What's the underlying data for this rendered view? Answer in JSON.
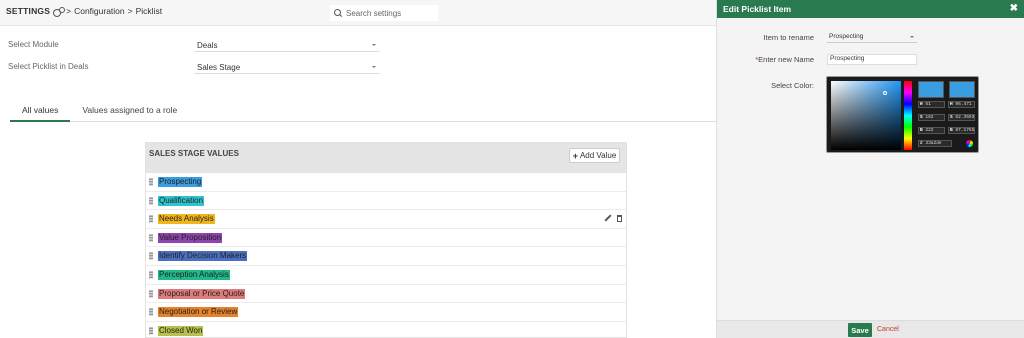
{
  "header": {
    "settings_label": "SETTINGS",
    "crumb_sep": ">",
    "breadcrumb": [
      "Configuration",
      "Picklist"
    ],
    "search_placeholder": "Search settings"
  },
  "filters": {
    "module_label": "Select Module",
    "module_value": "Deals",
    "picklist_label": "Select Picklist in Deals",
    "picklist_value": "Sales Stage"
  },
  "tabs": [
    {
      "label": "All values",
      "active": true
    },
    {
      "label": "Values assigned to a role",
      "active": false
    }
  ],
  "panel": {
    "title": "SALES STAGE VALUES",
    "add_icon": "plus-icon",
    "add_label": "Add Value",
    "values": [
      {
        "label": "Prospecting",
        "color": "#3a9de0"
      },
      {
        "label": "Qualification",
        "color": "#2ec4cf"
      },
      {
        "label": "Needs Analysis",
        "color": "#f2b61d"
      },
      {
        "label": "Value Proposition",
        "color": "#8e44ad"
      },
      {
        "label": "Identify Decision Makers",
        "color": "#4a6fc0"
      },
      {
        "label": "Perception Analysis",
        "color": "#1fb98a"
      },
      {
        "label": "Proposal or Price Quote",
        "color": "#e07b7b"
      },
      {
        "label": "Negotiation or Review",
        "color": "#e6822a"
      },
      {
        "label": "Closed Won",
        "color": "#b6c04a"
      }
    ]
  },
  "drawer": {
    "title": "Edit Picklist Item",
    "close_icon": "close-icon",
    "rename_label": "Item to rename",
    "rename_value": "Prospecting",
    "new_name_required": "*",
    "new_name_label": "Enter new Name",
    "new_name_value": "Prospecting",
    "color_label": "Select Color:",
    "picker": {
      "h": {
        "k": "H",
        "v": "51"
      },
      "h2": {
        "k": "H",
        "v": "96.471"
      },
      "s": {
        "k": "S",
        "v": "162"
      },
      "s2": {
        "k": "S",
        "v": "62.3593"
      },
      "b": {
        "k": "B",
        "v": "222"
      },
      "b2": {
        "k": "B",
        "v": "87.1765"
      },
      "hex": {
        "k": "#",
        "v": "33a2de"
      }
    },
    "save_label": "Save",
    "cancel_label": "Cancel"
  }
}
